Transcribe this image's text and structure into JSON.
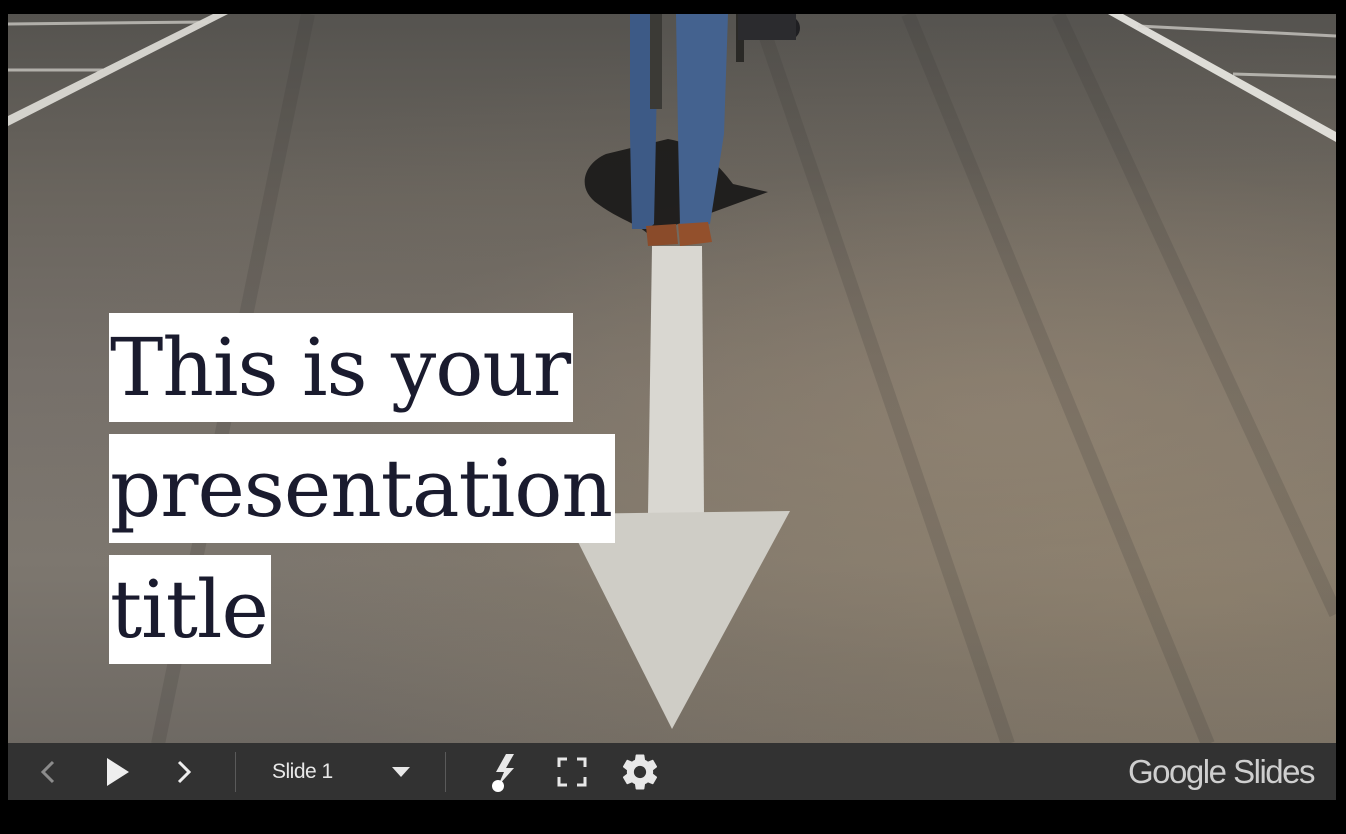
{
  "slide": {
    "title_lines": [
      "This is your",
      "presentation",
      "title"
    ],
    "background": "asphalt road with a painted white arrow and a person standing"
  },
  "toolbar": {
    "prev_icon": "chevron-left-icon",
    "play_icon": "play-icon",
    "next_icon": "chevron-right-icon",
    "slide_selector": {
      "label": "Slide 1"
    },
    "laser_icon": "laser-pointer-icon",
    "fullscreen_icon": "fullscreen-icon",
    "settings_icon": "gear-icon",
    "brand": {
      "google": "Google",
      "product": "Slides"
    }
  },
  "colors": {
    "toolbar_bg": "#323232",
    "title_text": "#1a1b2e",
    "title_highlight": "#ffffff",
    "frame": "#000000"
  }
}
